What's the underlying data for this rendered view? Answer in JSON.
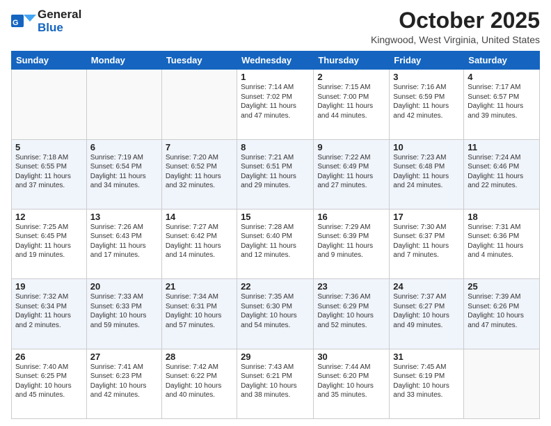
{
  "header": {
    "logo_general": "General",
    "logo_blue": "Blue",
    "month_title": "October 2025",
    "location": "Kingwood, West Virginia, United States"
  },
  "days_of_week": [
    "Sunday",
    "Monday",
    "Tuesday",
    "Wednesday",
    "Thursday",
    "Friday",
    "Saturday"
  ],
  "weeks": [
    [
      {
        "day": "",
        "info": ""
      },
      {
        "day": "",
        "info": ""
      },
      {
        "day": "",
        "info": ""
      },
      {
        "day": "1",
        "info": "Sunrise: 7:14 AM\nSunset: 7:02 PM\nDaylight: 11 hours and 47 minutes."
      },
      {
        "day": "2",
        "info": "Sunrise: 7:15 AM\nSunset: 7:00 PM\nDaylight: 11 hours and 44 minutes."
      },
      {
        "day": "3",
        "info": "Sunrise: 7:16 AM\nSunset: 6:59 PM\nDaylight: 11 hours and 42 minutes."
      },
      {
        "day": "4",
        "info": "Sunrise: 7:17 AM\nSunset: 6:57 PM\nDaylight: 11 hours and 39 minutes."
      }
    ],
    [
      {
        "day": "5",
        "info": "Sunrise: 7:18 AM\nSunset: 6:55 PM\nDaylight: 11 hours and 37 minutes."
      },
      {
        "day": "6",
        "info": "Sunrise: 7:19 AM\nSunset: 6:54 PM\nDaylight: 11 hours and 34 minutes."
      },
      {
        "day": "7",
        "info": "Sunrise: 7:20 AM\nSunset: 6:52 PM\nDaylight: 11 hours and 32 minutes."
      },
      {
        "day": "8",
        "info": "Sunrise: 7:21 AM\nSunset: 6:51 PM\nDaylight: 11 hours and 29 minutes."
      },
      {
        "day": "9",
        "info": "Sunrise: 7:22 AM\nSunset: 6:49 PM\nDaylight: 11 hours and 27 minutes."
      },
      {
        "day": "10",
        "info": "Sunrise: 7:23 AM\nSunset: 6:48 PM\nDaylight: 11 hours and 24 minutes."
      },
      {
        "day": "11",
        "info": "Sunrise: 7:24 AM\nSunset: 6:46 PM\nDaylight: 11 hours and 22 minutes."
      }
    ],
    [
      {
        "day": "12",
        "info": "Sunrise: 7:25 AM\nSunset: 6:45 PM\nDaylight: 11 hours and 19 minutes."
      },
      {
        "day": "13",
        "info": "Sunrise: 7:26 AM\nSunset: 6:43 PM\nDaylight: 11 hours and 17 minutes."
      },
      {
        "day": "14",
        "info": "Sunrise: 7:27 AM\nSunset: 6:42 PM\nDaylight: 11 hours and 14 minutes."
      },
      {
        "day": "15",
        "info": "Sunrise: 7:28 AM\nSunset: 6:40 PM\nDaylight: 11 hours and 12 minutes."
      },
      {
        "day": "16",
        "info": "Sunrise: 7:29 AM\nSunset: 6:39 PM\nDaylight: 11 hours and 9 minutes."
      },
      {
        "day": "17",
        "info": "Sunrise: 7:30 AM\nSunset: 6:37 PM\nDaylight: 11 hours and 7 minutes."
      },
      {
        "day": "18",
        "info": "Sunrise: 7:31 AM\nSunset: 6:36 PM\nDaylight: 11 hours and 4 minutes."
      }
    ],
    [
      {
        "day": "19",
        "info": "Sunrise: 7:32 AM\nSunset: 6:34 PM\nDaylight: 11 hours and 2 minutes."
      },
      {
        "day": "20",
        "info": "Sunrise: 7:33 AM\nSunset: 6:33 PM\nDaylight: 10 hours and 59 minutes."
      },
      {
        "day": "21",
        "info": "Sunrise: 7:34 AM\nSunset: 6:31 PM\nDaylight: 10 hours and 57 minutes."
      },
      {
        "day": "22",
        "info": "Sunrise: 7:35 AM\nSunset: 6:30 PM\nDaylight: 10 hours and 54 minutes."
      },
      {
        "day": "23",
        "info": "Sunrise: 7:36 AM\nSunset: 6:29 PM\nDaylight: 10 hours and 52 minutes."
      },
      {
        "day": "24",
        "info": "Sunrise: 7:37 AM\nSunset: 6:27 PM\nDaylight: 10 hours and 49 minutes."
      },
      {
        "day": "25",
        "info": "Sunrise: 7:39 AM\nSunset: 6:26 PM\nDaylight: 10 hours and 47 minutes."
      }
    ],
    [
      {
        "day": "26",
        "info": "Sunrise: 7:40 AM\nSunset: 6:25 PM\nDaylight: 10 hours and 45 minutes."
      },
      {
        "day": "27",
        "info": "Sunrise: 7:41 AM\nSunset: 6:23 PM\nDaylight: 10 hours and 42 minutes."
      },
      {
        "day": "28",
        "info": "Sunrise: 7:42 AM\nSunset: 6:22 PM\nDaylight: 10 hours and 40 minutes."
      },
      {
        "day": "29",
        "info": "Sunrise: 7:43 AM\nSunset: 6:21 PM\nDaylight: 10 hours and 38 minutes."
      },
      {
        "day": "30",
        "info": "Sunrise: 7:44 AM\nSunset: 6:20 PM\nDaylight: 10 hours and 35 minutes."
      },
      {
        "day": "31",
        "info": "Sunrise: 7:45 AM\nSunset: 6:19 PM\nDaylight: 10 hours and 33 minutes."
      },
      {
        "day": "",
        "info": ""
      }
    ]
  ]
}
